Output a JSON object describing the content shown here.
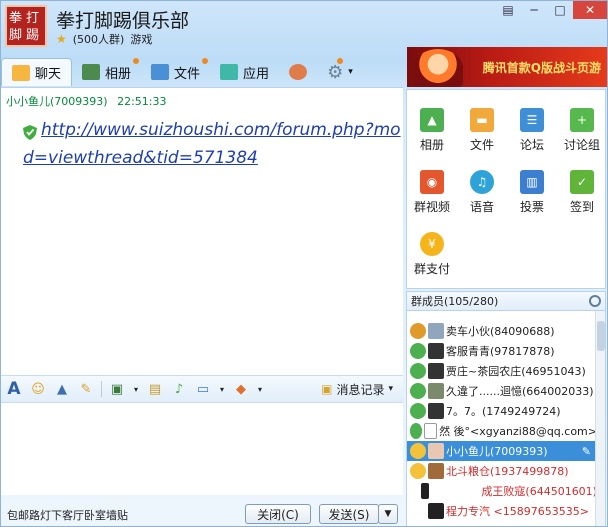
{
  "window": {
    "logo_top": "拳打",
    "logo_bottom": "脚踢",
    "title": "拳打脚踢俱乐部",
    "subtitle_count": "(500人群)",
    "subtitle_tag": "游戏"
  },
  "tabs": [
    {
      "label": "聊天",
      "icon": "chat-icon"
    },
    {
      "label": "相册",
      "icon": "album-icon"
    },
    {
      "label": "文件",
      "icon": "folder-icon"
    },
    {
      "label": "应用",
      "icon": "apps-icon"
    }
  ],
  "banner_text": "腾讯首款Q版战斗页游",
  "chat": {
    "sender": "小小鱼儿(7009393)",
    "time": "22:51:33",
    "message": "http://www.suizhoushi.com/forum.php?mod=viewthread&tid=571384"
  },
  "toolbar": {
    "history_label": "消息记录"
  },
  "footer": {
    "status_text": "包邮路灯下客厅卧室墙贴",
    "close_label": "关闭(C)",
    "send_label": "发送(S)"
  },
  "apps": [
    {
      "label": "相册",
      "color": "#4caf50"
    },
    {
      "label": "文件",
      "color": "#f0a93a"
    },
    {
      "label": "论坛",
      "color": "#3f8fd6"
    },
    {
      "label": "讨论组",
      "color": "#57b84d"
    },
    {
      "label": "群视频",
      "color": "#e4572e"
    },
    {
      "label": "语音",
      "color": "#2ea3d8"
    },
    {
      "label": "投票",
      "color": "#3c7fd1"
    },
    {
      "label": "签到",
      "color": "#61b43a"
    },
    {
      "label": "群支付",
      "color": "#f4b41a"
    }
  ],
  "members_header": "群成员(105/280)",
  "members": [
    {
      "name": "卖车小伙(84090688)",
      "color": "#222222"
    },
    {
      "name": "客服青青(97817878)",
      "color": "#222222"
    },
    {
      "name": "贾庄~茶园农庄(46951043)",
      "color": "#222222"
    },
    {
      "name": "久違了......迴憶(664002033)",
      "color": "#222222"
    },
    {
      "name": "7。7。(1749249724)",
      "color": "#222222"
    },
    {
      "name": "然 後°<xgyanzi88@qq.com>",
      "color": "#222222"
    },
    {
      "name": "小小鱼儿(7009393)",
      "color": "#ffffff"
    },
    {
      "name": "北斗粮仓(1937499878)",
      "color": "#d22c2c"
    },
    {
      "name": "成王败寇(644501601)",
      "color": "#d22c2c"
    },
    {
      "name": "程力专汽 <15897653535>",
      "color": "#d22c2c"
    }
  ]
}
